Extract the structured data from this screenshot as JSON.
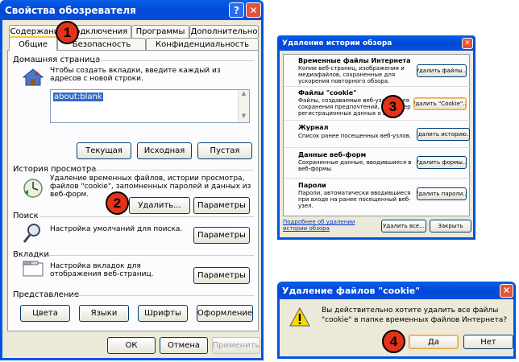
{
  "main_dialog": {
    "title": "Свойства обозревателя",
    "tabs_row1": [
      "Содержание",
      "Подключения",
      "Программы",
      "Дополнительно"
    ],
    "tabs_row2": [
      "Общие",
      "Безопасность",
      "Конфиденциальность"
    ],
    "home": {
      "heading": "Домашняя страница",
      "desc": "Чтобы создать вкладки, введите каждый из адресов с новой строки.",
      "url": "about:blank",
      "btn_current": "Текущая",
      "btn_original": "Исходная",
      "btn_empty": "Пустая"
    },
    "history": {
      "heading": "История просмотра",
      "desc": "Удаление временных файлов, истории просмотра, файлов \"cookie\", запомненных паролей и данных из веб-форм.",
      "btn_delete": "Удалить...",
      "btn_params": "Параметры"
    },
    "search": {
      "heading": "Поиск",
      "desc": "Настройка умолчаний для поиска.",
      "btn_params": "Параметры"
    },
    "tabs": {
      "heading": "Вкладки",
      "desc": "Настройка вкладок для отображения веб-страниц.",
      "btn_params": "Параметры"
    },
    "appearance": {
      "heading": "Представление",
      "btn_colors": "Цвета",
      "btn_languages": "Языки",
      "btn_fonts": "Шрифты",
      "btn_design": "Оформление"
    },
    "ok": "ОК",
    "cancel": "Отмена",
    "apply": "Применить"
  },
  "history_dialog": {
    "title": "Удаление истории обзора",
    "sections": [
      {
        "heading": "Временные файлы Интернета",
        "desc": "Копии веб-страниц, изображения и медиафайлов, сохраненные для ускорения повторного обзора.",
        "button": "Удалить файлы..."
      },
      {
        "heading": "Файлы \"cookie\"",
        "desc": "Файлы, создаваемые веб-узлами для сохранения предпочтений, например регистрационных данных о входе.",
        "button": "Удалить \"Cookie\"..."
      },
      {
        "heading": "Журнал",
        "desc": "Список ранее посещенных веб-узлов.",
        "button": "Удалить историю..."
      },
      {
        "heading": "Данные веб-форм",
        "desc": "Сохраненные данные, вводившиеся в веб-формы.",
        "button": "Удалить формы..."
      },
      {
        "heading": "Пароли",
        "desc": "Пароли, автоматически вводившиеся при входе на ранее посещенный веб-узел.",
        "button": "Удалить пароли..."
      }
    ],
    "link": "Подробнее об удалении истории обзора",
    "btn_delete_all": "Удалить все...",
    "btn_close": "Закрыть"
  },
  "confirm_dialog": {
    "title": "Удаление файлов \"cookie\"",
    "message": "Вы действительно хотите удалить все файлы \"cookie\" в папке временных файлов Интернета?",
    "yes": "Да",
    "no": "Нет"
  },
  "markers": [
    "1",
    "2",
    "3",
    "4"
  ],
  "colors": {
    "title_blue": "#0054e3",
    "dialog_bg": "#ece9d8",
    "marker_red": "#e53218",
    "close_red": "#e2533a"
  }
}
